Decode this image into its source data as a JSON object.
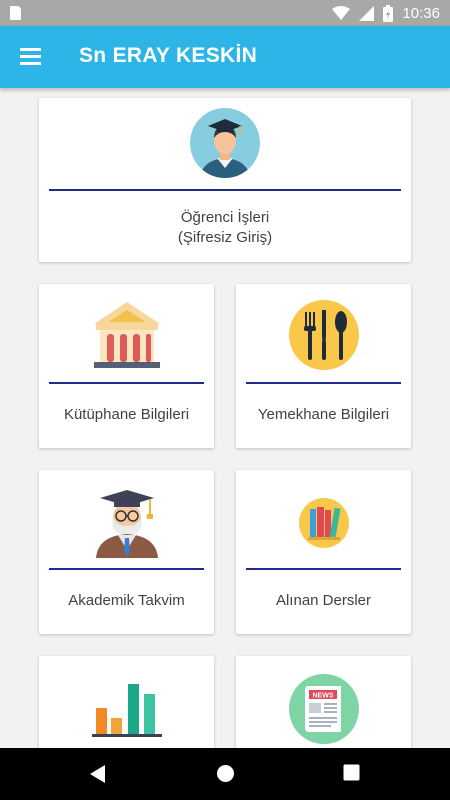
{
  "status_bar": {
    "time": "10:36"
  },
  "app_bar": {
    "title": "Sn ERAY KESKİN"
  },
  "cards": {
    "ogrenci": {
      "line1": "Öğrenci İşleri",
      "line2": "(Şifresiz Giriş)"
    },
    "kutuphane": {
      "label": "Kütüphane Bilgileri"
    },
    "yemekhane": {
      "label": "Yemekhane Bilgileri"
    },
    "akademik": {
      "label": "Akademik Takvim"
    },
    "dersler": {
      "label": "Alınan Dersler"
    },
    "news": {
      "badge": "NEWS"
    }
  },
  "colors": {
    "app_bar": "#2eb5e8",
    "divider": "#1f2a8a",
    "status_bar": "#a8a8a8"
  }
}
